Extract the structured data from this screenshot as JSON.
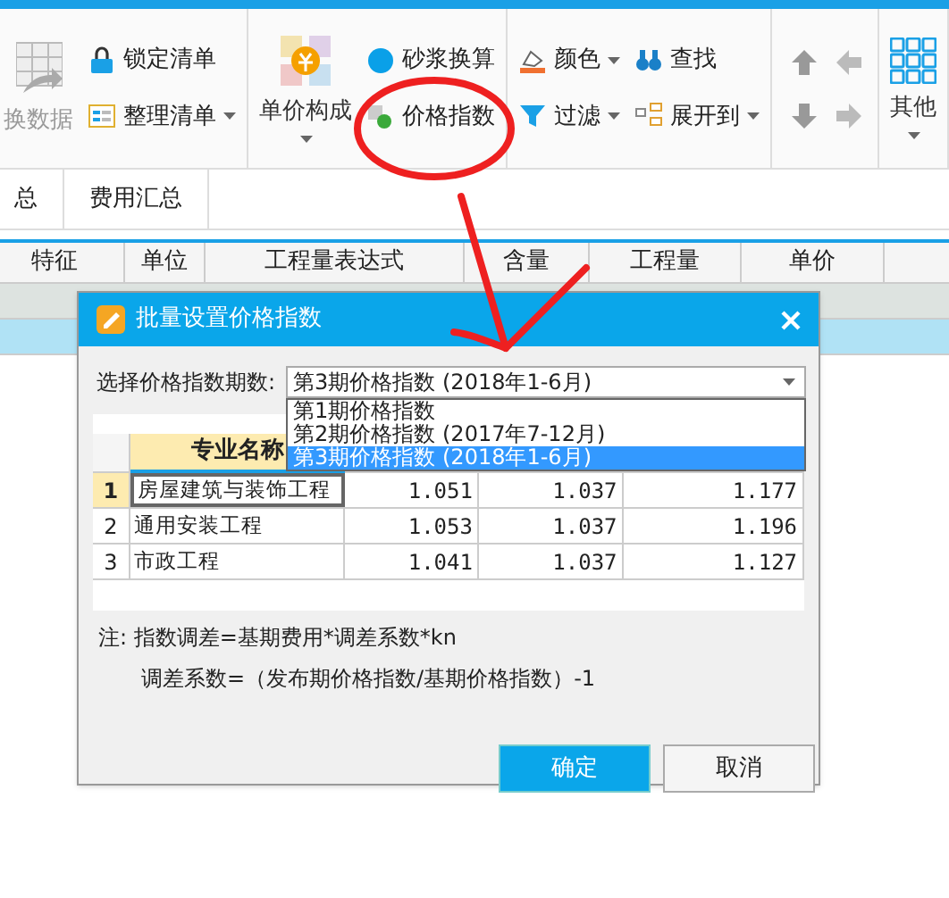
{
  "ribbon": {
    "groups": [
      {
        "columns": [
          {
            "kind": "large",
            "label": "换数据",
            "dropdown": false
          },
          {
            "kind": "stack",
            "items": [
              {
                "label": "锁定清单",
                "dropdown": false
              },
              {
                "label": "整理清单",
                "dropdown": true
              }
            ]
          }
        ]
      },
      {
        "columns": [
          {
            "kind": "large",
            "label": "单价构成",
            "dropdown": true
          },
          {
            "kind": "stack",
            "items": [
              {
                "label": "砂浆换算",
                "dropdown": false
              },
              {
                "label": "价格指数",
                "dropdown": false
              }
            ]
          }
        ]
      },
      {
        "columns": [
          {
            "kind": "stack",
            "items": [
              {
                "label": "颜色",
                "dropdown": true
              },
              {
                "label": "过滤",
                "dropdown": true
              }
            ]
          },
          {
            "kind": "stack",
            "items": [
              {
                "label": "查找",
                "dropdown": false
              },
              {
                "label": "展开到",
                "dropdown": true
              }
            ]
          }
        ]
      },
      {
        "columns": [
          {
            "kind": "arrows"
          }
        ]
      },
      {
        "columns": [
          {
            "kind": "large",
            "label": "其他",
            "dropdown": true
          }
        ]
      }
    ]
  },
  "tabs": [
    {
      "label": "总",
      "selected": false
    },
    {
      "label": "费用汇总",
      "selected": false
    }
  ],
  "table": {
    "columns": [
      "特征",
      "单位",
      "工程量表达式",
      "含量",
      "工程量",
      "单价"
    ],
    "rows": [
      {
        "selected": false
      },
      {
        "selected": true
      }
    ]
  },
  "dialog": {
    "title": "批量设置价格指数",
    "period_label": "选择价格指数期数:",
    "period_value": "第3期价格指数 (2018年1-6月)",
    "options": [
      {
        "label": "第1期价格指数",
        "selected": false
      },
      {
        "label": "第2期价格指数 (2017年7-12月)",
        "selected": false
      },
      {
        "label": "第3期价格指数 (2018年1-6月)",
        "selected": true
      }
    ],
    "grid": {
      "header": "专业名称",
      "rows": [
        {
          "number": "1",
          "name": "房屋建筑与装饰工程",
          "values": [
            "1.051",
            "1.037",
            "1.177"
          ],
          "selected": true
        },
        {
          "number": "2",
          "name": "通用安装工程",
          "values": [
            "1.053",
            "1.037",
            "1.196"
          ],
          "selected": false
        },
        {
          "number": "3",
          "name": "市政工程",
          "values": [
            "1.041",
            "1.037",
            "1.127"
          ],
          "selected": false
        }
      ]
    },
    "notes": [
      "注: 指数调差=基期费用*调差系数*kn",
      "调差系数=（发布期价格指数/基期价格指数）-1"
    ],
    "buttons": [
      {
        "label": "确定",
        "kind": "primary"
      },
      {
        "label": "取消",
        "kind": "secondary"
      }
    ]
  }
}
